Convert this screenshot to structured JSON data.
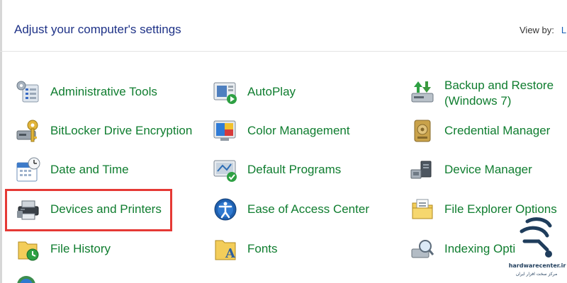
{
  "header": {
    "title": "Adjust your computer's settings",
    "view_by_label": "View by:",
    "view_by_value": "L"
  },
  "items": [
    {
      "label": "Administrative Tools",
      "icon": "administrative-tools-icon"
    },
    {
      "label": "AutoPlay",
      "icon": "autoplay-icon"
    },
    {
      "label": "Backup and Restore (Windows 7)",
      "line1": "Backup and Restore",
      "line2": "(Windows 7)",
      "icon": "backup-restore-icon"
    },
    {
      "label": "BitLocker Drive Encryption",
      "icon": "bitlocker-icon"
    },
    {
      "label": "Color Management",
      "icon": "color-management-icon"
    },
    {
      "label": "Credential Manager",
      "icon": "credential-manager-icon"
    },
    {
      "label": "Date and Time",
      "icon": "calendar-clock-icon"
    },
    {
      "label": "Default Programs",
      "icon": "default-programs-icon"
    },
    {
      "label": "Device Manager",
      "icon": "device-manager-icon"
    },
    {
      "label": "Devices and Printers",
      "icon": "printer-icon"
    },
    {
      "label": "Ease of Access Center",
      "icon": "ease-of-access-icon"
    },
    {
      "label": "File Explorer Options",
      "icon": "folder-options-icon"
    },
    {
      "label": "File History",
      "icon": "file-history-icon"
    },
    {
      "label": "Fonts",
      "icon": "fonts-icon"
    },
    {
      "label": "Indexing Opti",
      "icon": "indexing-options-icon"
    }
  ],
  "watermark": {
    "name": "hardwarecenter.ir",
    "subtitle": "مرکز سخت افزار ایران"
  },
  "colors": {
    "link_green": "#0f7d2f",
    "header_blue": "#1e3287",
    "highlight_red": "#e53935"
  }
}
